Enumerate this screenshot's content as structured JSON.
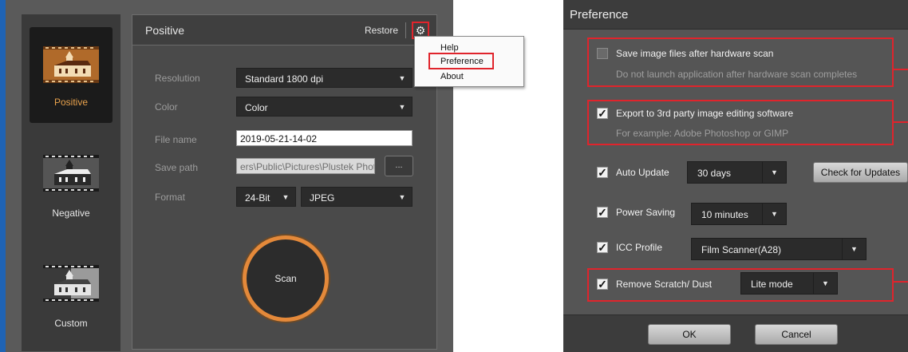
{
  "app": {
    "modes": [
      {
        "label": "Positive",
        "active": true
      },
      {
        "label": "Negative",
        "active": false
      },
      {
        "label": "Custom",
        "active": false
      }
    ],
    "panel_title": "Positive",
    "restore_label": "Restore",
    "fields": {
      "resolution": {
        "label": "Resolution",
        "value": "Standard 1800 dpi"
      },
      "color": {
        "label": "Color",
        "value": "Color"
      },
      "file_name": {
        "label": "File name",
        "value": "2019-05-21-14-02"
      },
      "save_path": {
        "label": "Save path",
        "value": "ers\\Public\\Pictures\\Plustek Photo",
        "browse": "..."
      },
      "format": {
        "label": "Format",
        "bit_depth": "24-Bit",
        "file_type": "JPEG"
      }
    },
    "scan_label": "Scan",
    "menu": [
      "Help",
      "Preference",
      "About"
    ]
  },
  "preference": {
    "title": "Preference",
    "save_after_scan": {
      "label": "Save image files after hardware scan",
      "checked": false,
      "hint": "Do not launch application after hardware scan completes"
    },
    "export": {
      "label": "Export to 3rd party image editing software",
      "checked": true,
      "hint": "For example: Adobe Photoshop or GIMP"
    },
    "auto_update": {
      "label": "Auto Update",
      "checked": true,
      "value": "30 days",
      "button": "Check for Updates"
    },
    "power_saving": {
      "label": "Power Saving",
      "checked": true,
      "value": "10 minutes"
    },
    "icc_profile": {
      "label": "ICC Profile",
      "checked": true,
      "value": "Film Scanner(A28)"
    },
    "remove_scratch": {
      "label": "Remove Scratch/ Dust",
      "checked": true,
      "value": "Lite mode"
    },
    "ok_label": "OK",
    "cancel_label": "Cancel"
  },
  "colors": {
    "accent": "#e4893a",
    "highlight": "#e0242c",
    "brand_bar": "#1f63b4"
  }
}
